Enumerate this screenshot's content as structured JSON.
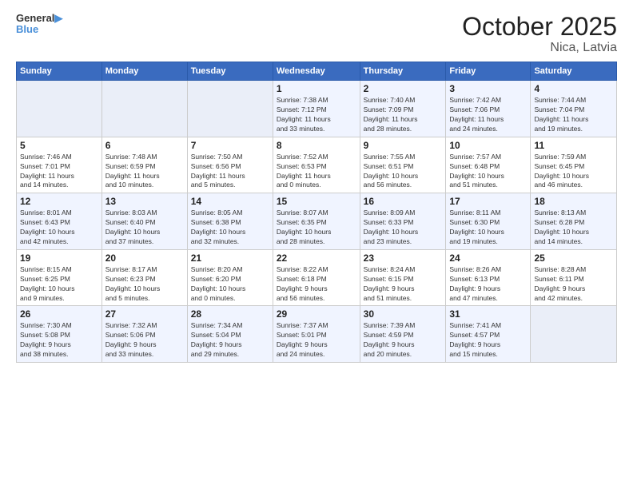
{
  "header": {
    "logo_line1": "General",
    "logo_line2": "Blue",
    "month": "October 2025",
    "location": "Nica, Latvia"
  },
  "weekdays": [
    "Sunday",
    "Monday",
    "Tuesday",
    "Wednesday",
    "Thursday",
    "Friday",
    "Saturday"
  ],
  "weeks": [
    [
      {
        "day": "",
        "info": ""
      },
      {
        "day": "",
        "info": ""
      },
      {
        "day": "",
        "info": ""
      },
      {
        "day": "1",
        "info": "Sunrise: 7:38 AM\nSunset: 7:12 PM\nDaylight: 11 hours\nand 33 minutes."
      },
      {
        "day": "2",
        "info": "Sunrise: 7:40 AM\nSunset: 7:09 PM\nDaylight: 11 hours\nand 28 minutes."
      },
      {
        "day": "3",
        "info": "Sunrise: 7:42 AM\nSunset: 7:06 PM\nDaylight: 11 hours\nand 24 minutes."
      },
      {
        "day": "4",
        "info": "Sunrise: 7:44 AM\nSunset: 7:04 PM\nDaylight: 11 hours\nand 19 minutes."
      }
    ],
    [
      {
        "day": "5",
        "info": "Sunrise: 7:46 AM\nSunset: 7:01 PM\nDaylight: 11 hours\nand 14 minutes."
      },
      {
        "day": "6",
        "info": "Sunrise: 7:48 AM\nSunset: 6:59 PM\nDaylight: 11 hours\nand 10 minutes."
      },
      {
        "day": "7",
        "info": "Sunrise: 7:50 AM\nSunset: 6:56 PM\nDaylight: 11 hours\nand 5 minutes."
      },
      {
        "day": "8",
        "info": "Sunrise: 7:52 AM\nSunset: 6:53 PM\nDaylight: 11 hours\nand 0 minutes."
      },
      {
        "day": "9",
        "info": "Sunrise: 7:55 AM\nSunset: 6:51 PM\nDaylight: 10 hours\nand 56 minutes."
      },
      {
        "day": "10",
        "info": "Sunrise: 7:57 AM\nSunset: 6:48 PM\nDaylight: 10 hours\nand 51 minutes."
      },
      {
        "day": "11",
        "info": "Sunrise: 7:59 AM\nSunset: 6:45 PM\nDaylight: 10 hours\nand 46 minutes."
      }
    ],
    [
      {
        "day": "12",
        "info": "Sunrise: 8:01 AM\nSunset: 6:43 PM\nDaylight: 10 hours\nand 42 minutes."
      },
      {
        "day": "13",
        "info": "Sunrise: 8:03 AM\nSunset: 6:40 PM\nDaylight: 10 hours\nand 37 minutes."
      },
      {
        "day": "14",
        "info": "Sunrise: 8:05 AM\nSunset: 6:38 PM\nDaylight: 10 hours\nand 32 minutes."
      },
      {
        "day": "15",
        "info": "Sunrise: 8:07 AM\nSunset: 6:35 PM\nDaylight: 10 hours\nand 28 minutes."
      },
      {
        "day": "16",
        "info": "Sunrise: 8:09 AM\nSunset: 6:33 PM\nDaylight: 10 hours\nand 23 minutes."
      },
      {
        "day": "17",
        "info": "Sunrise: 8:11 AM\nSunset: 6:30 PM\nDaylight: 10 hours\nand 19 minutes."
      },
      {
        "day": "18",
        "info": "Sunrise: 8:13 AM\nSunset: 6:28 PM\nDaylight: 10 hours\nand 14 minutes."
      }
    ],
    [
      {
        "day": "19",
        "info": "Sunrise: 8:15 AM\nSunset: 6:25 PM\nDaylight: 10 hours\nand 9 minutes."
      },
      {
        "day": "20",
        "info": "Sunrise: 8:17 AM\nSunset: 6:23 PM\nDaylight: 10 hours\nand 5 minutes."
      },
      {
        "day": "21",
        "info": "Sunrise: 8:20 AM\nSunset: 6:20 PM\nDaylight: 10 hours\nand 0 minutes."
      },
      {
        "day": "22",
        "info": "Sunrise: 8:22 AM\nSunset: 6:18 PM\nDaylight: 9 hours\nand 56 minutes."
      },
      {
        "day": "23",
        "info": "Sunrise: 8:24 AM\nSunset: 6:15 PM\nDaylight: 9 hours\nand 51 minutes."
      },
      {
        "day": "24",
        "info": "Sunrise: 8:26 AM\nSunset: 6:13 PM\nDaylight: 9 hours\nand 47 minutes."
      },
      {
        "day": "25",
        "info": "Sunrise: 8:28 AM\nSunset: 6:11 PM\nDaylight: 9 hours\nand 42 minutes."
      }
    ],
    [
      {
        "day": "26",
        "info": "Sunrise: 7:30 AM\nSunset: 5:08 PM\nDaylight: 9 hours\nand 38 minutes."
      },
      {
        "day": "27",
        "info": "Sunrise: 7:32 AM\nSunset: 5:06 PM\nDaylight: 9 hours\nand 33 minutes."
      },
      {
        "day": "28",
        "info": "Sunrise: 7:34 AM\nSunset: 5:04 PM\nDaylight: 9 hours\nand 29 minutes."
      },
      {
        "day": "29",
        "info": "Sunrise: 7:37 AM\nSunset: 5:01 PM\nDaylight: 9 hours\nand 24 minutes."
      },
      {
        "day": "30",
        "info": "Sunrise: 7:39 AM\nSunset: 4:59 PM\nDaylight: 9 hours\nand 20 minutes."
      },
      {
        "day": "31",
        "info": "Sunrise: 7:41 AM\nSunset: 4:57 PM\nDaylight: 9 hours\nand 15 minutes."
      },
      {
        "day": "",
        "info": ""
      }
    ]
  ]
}
